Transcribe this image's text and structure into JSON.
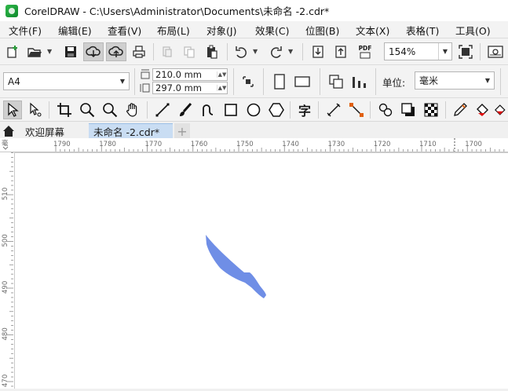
{
  "window": {
    "title": "CorelDRAW - C:\\Users\\Administrator\\Documents\\未命名 -2.cdr*"
  },
  "menu": [
    "文件(F)",
    "编辑(E)",
    "查看(V)",
    "布局(L)",
    "对象(J)",
    "效果(C)",
    "位图(B)",
    "文本(X)",
    "表格(T)",
    "工具(O)"
  ],
  "standard_toolbar": {
    "zoom_value": "154%",
    "pdf_label": "PDF"
  },
  "property_bar": {
    "page_size": "A4",
    "width": "210.0 mm",
    "height": "297.0 mm",
    "units_label": "单位:",
    "units_value": "毫米"
  },
  "toolbox": {
    "text_tool_glyph": "字"
  },
  "tabs": {
    "welcome": "欢迎屏幕",
    "document": "未命名 -2.cdr*",
    "add": "+"
  },
  "rulers": {
    "horizontal_labels": [
      "1790",
      "1780",
      "1770",
      "1760",
      "1750",
      "1740",
      "1730",
      "1720",
      "1710",
      "1700"
    ],
    "vertical_labels": [
      "510",
      "500",
      "490",
      "480",
      "470"
    ]
  },
  "canvas": {
    "shape_color": "#6f8ee6",
    "background": "#ffffff"
  }
}
